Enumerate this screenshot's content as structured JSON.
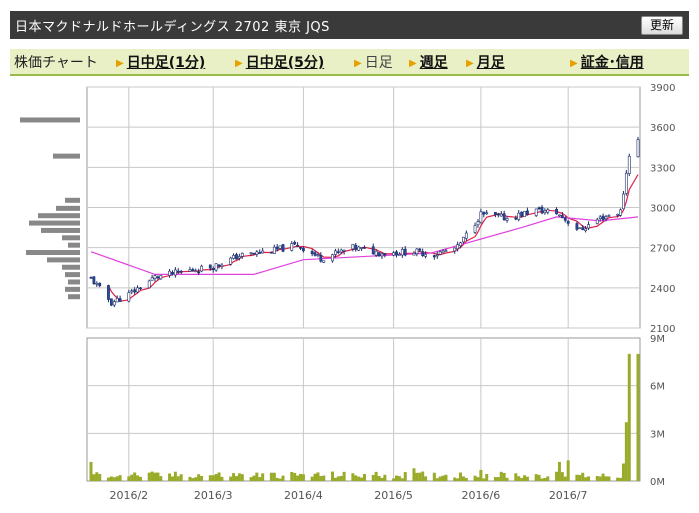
{
  "header": {
    "title": "日本マクドナルドホールディングス 2702 東京 JQS",
    "update_label": "更新"
  },
  "tabs": [
    {
      "label": "株価チャート",
      "kind": "static"
    },
    {
      "label": "日中足(1分)",
      "kind": "link"
    },
    {
      "label": "日中足(5分)",
      "kind": "link"
    },
    {
      "label": "日足",
      "kind": "current"
    },
    {
      "label": "週足",
      "kind": "link"
    },
    {
      "label": "月足",
      "kind": "link"
    },
    {
      "label": "証金･信用",
      "kind": "link"
    }
  ],
  "colors": {
    "up_candle": "#ffffff",
    "down_candle": "#2a4a9a",
    "ma_short": "#e0204a",
    "ma_long": "#e040e0",
    "volume": "#9aab2a",
    "volume_profile": "#888888",
    "grid": "#c8c8c8"
  },
  "chart_data": [
    {
      "type": "candlestick",
      "title": "",
      "x_ticks": [
        "2016/2",
        "2016/3",
        "2016/4",
        "2016/5",
        "2016/6",
        "2016/7"
      ],
      "y_ticks": [
        2100,
        2400,
        2700,
        3000,
        3300,
        3600,
        3900
      ],
      "ylim": [
        2100,
        3900
      ],
      "close_trajectory": [
        [
          "2016-01-19",
          2470
        ],
        [
          "2016-01-26",
          2290
        ],
        [
          "2016-02-01",
          2350
        ],
        [
          "2016-02-10",
          2480
        ],
        [
          "2016-02-22",
          2530
        ],
        [
          "2016-03-01",
          2560
        ],
        [
          "2016-03-10",
          2640
        ],
        [
          "2016-03-22",
          2680
        ],
        [
          "2016-03-30",
          2720
        ],
        [
          "2016-04-07",
          2620
        ],
        [
          "2016-04-18",
          2700
        ],
        [
          "2016-04-28",
          2660
        ],
        [
          "2016-05-09",
          2670
        ],
        [
          "2016-05-16",
          2650
        ],
        [
          "2016-05-24",
          2700
        ],
        [
          "2016-06-01",
          2950
        ],
        [
          "2016-06-10",
          2920
        ],
        [
          "2016-06-20",
          2980
        ],
        [
          "2016-06-27",
          2960
        ],
        [
          "2016-07-05",
          2830
        ],
        [
          "2016-07-12",
          2920
        ],
        [
          "2016-07-19",
          2970
        ],
        [
          "2016-07-22",
          3400
        ],
        [
          "2016-07-25",
          3500
        ]
      ],
      "moving_averages": [
        {
          "name": "short",
          "color": "#e0204a"
        },
        {
          "name": "long",
          "color": "#e040e0",
          "points": [
            [
              "2016-01-19",
              2670
            ],
            [
              "2016-02-10",
              2500
            ],
            [
              "2016-03-15",
              2500
            ],
            [
              "2016-04-01",
              2610
            ],
            [
              "2016-05-15",
              2660
            ],
            [
              "2016-06-15",
              2850
            ],
            [
              "2016-06-27",
              2930
            ],
            [
              "2016-07-12",
              2900
            ],
            [
              "2016-07-25",
              2930
            ]
          ]
        }
      ],
      "volume_profile": [
        {
          "price": 3650,
          "weight": 1.0
        },
        {
          "price": 3380,
          "weight": 0.45
        },
        {
          "price": 3050,
          "weight": 0.25
        },
        {
          "price": 2990,
          "weight": 0.4
        },
        {
          "price": 2935,
          "weight": 0.7
        },
        {
          "price": 2880,
          "weight": 0.85
        },
        {
          "price": 2825,
          "weight": 0.65
        },
        {
          "price": 2770,
          "weight": 0.3
        },
        {
          "price": 2715,
          "weight": 0.2
        },
        {
          "price": 2660,
          "weight": 0.9
        },
        {
          "price": 2605,
          "weight": 0.55
        },
        {
          "price": 2550,
          "weight": 0.3
        },
        {
          "price": 2495,
          "weight": 0.25
        },
        {
          "price": 2440,
          "weight": 0.2
        },
        {
          "price": 2385,
          "weight": 0.25
        },
        {
          "price": 2330,
          "weight": 0.2
        }
      ]
    },
    {
      "type": "bar",
      "title": "",
      "y_ticks": [
        "0M",
        "3M",
        "6M",
        "9M"
      ],
      "ylim": [
        0,
        9
      ],
      "unit": "M shares",
      "base_volume_range": [
        0.15,
        0.6
      ],
      "notable_values": [
        [
          "2016-01-19",
          1.2
        ],
        [
          "2016-05-09",
          0.8
        ],
        [
          "2016-06-01",
          0.7
        ],
        [
          "2016-06-28",
          1.2
        ],
        [
          "2016-07-01",
          1.3
        ],
        [
          "2016-07-20",
          1.1
        ],
        [
          "2016-07-21",
          3.7
        ],
        [
          "2016-07-22",
          8.0
        ],
        [
          "2016-07-25",
          8.0
        ]
      ]
    }
  ]
}
